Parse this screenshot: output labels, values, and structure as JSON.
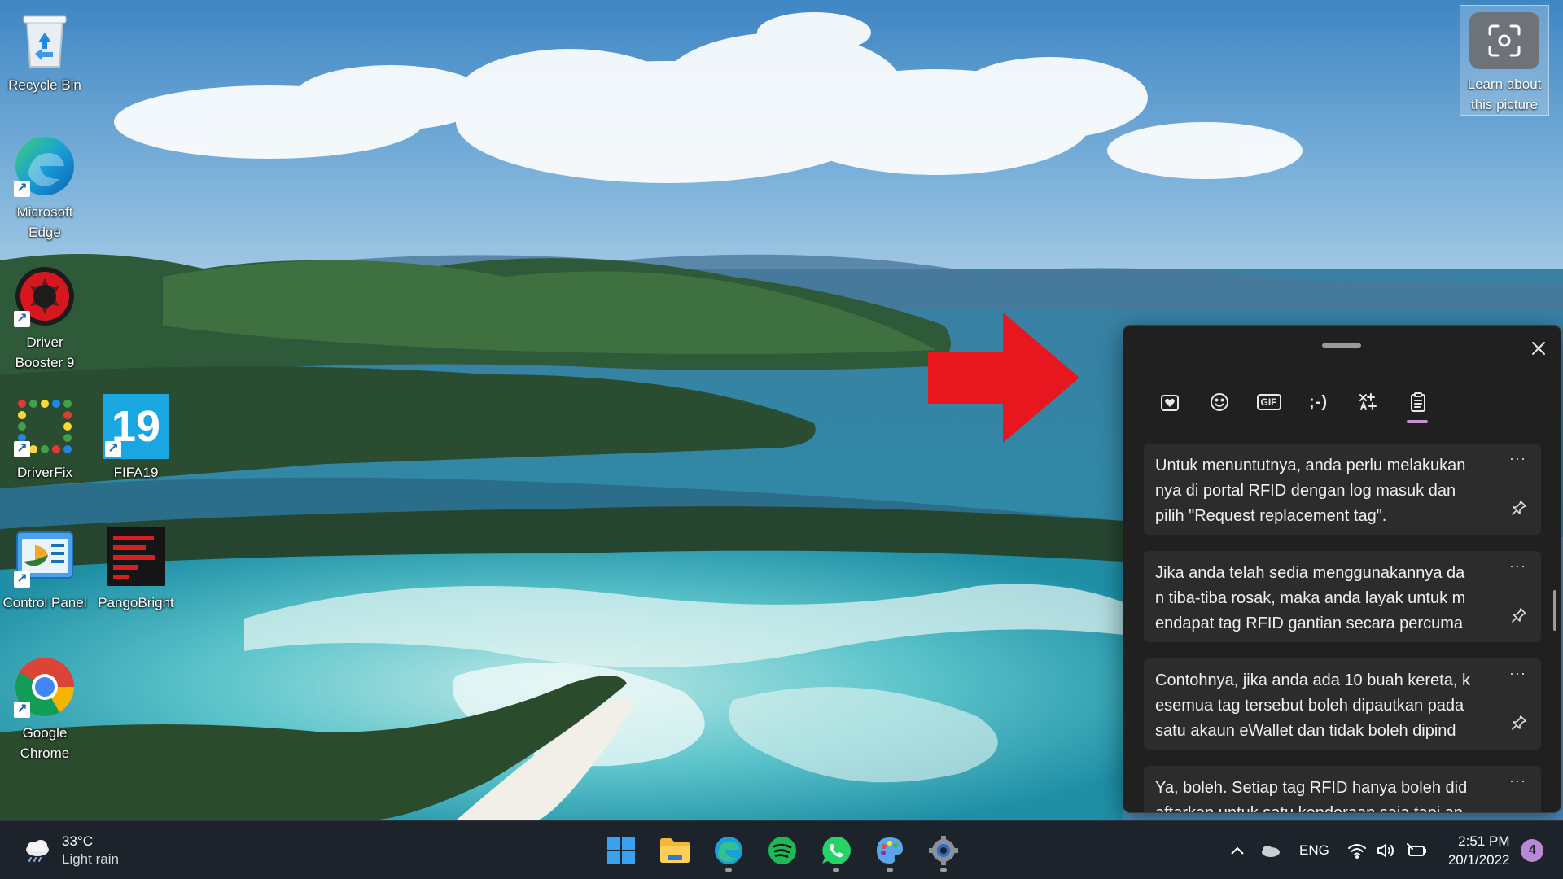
{
  "desktop": {
    "icons": [
      {
        "label": "Recycle Bin"
      },
      {
        "label": "Microsoft\nEdge"
      },
      {
        "label": "Driver\nBooster 9"
      },
      {
        "label": "DriverFix"
      },
      {
        "label": "FIFA19"
      },
      {
        "label": "Control Panel"
      },
      {
        "label": "PangoBright"
      },
      {
        "label": "Google\nChrome"
      }
    ],
    "learn_tile_label": "Learn about\nthis picture",
    "fifa_glyph_text": "19"
  },
  "panel": {
    "tabs": [
      {
        "icon": "heart-icon",
        "text": ""
      },
      {
        "icon": "smiley-icon",
        "text": ""
      },
      {
        "icon": "gif-icon",
        "text": "GIF"
      },
      {
        "icon": "kaomoji-icon",
        "text": ";-)"
      },
      {
        "icon": "symbols-icon",
        "text": ""
      },
      {
        "icon": "clipboard-icon",
        "text": ""
      }
    ],
    "active_tab": 5,
    "clipboard_items": [
      {
        "text": "Untuk menuntutnya, anda perlu melakukan\nnya di portal RFID dengan log masuk dan\npilih \"Request replacement tag\"."
      },
      {
        "text": "Jika anda telah sedia menggunakannya da\nn tiba-tiba rosak, maka anda layak untuk m\nendapat tag RFID gantian secara percuma"
      },
      {
        "text": "Contohnya, jika anda ada 10 buah kereta, k\nesemua tag tersebut boleh dipautkan pada\nsatu akaun eWallet dan tidak boleh dipind"
      },
      {
        "text": "Ya, boleh. Setiap tag RFID hanya boleh did\naftarkan untuk satu kenderaan saja tapi an"
      }
    ],
    "more_glyph": "···"
  },
  "taskbar": {
    "weather": {
      "temp": "33°C",
      "condition": "Light rain"
    },
    "apps": [
      "start",
      "file-explorer",
      "edge",
      "spotify",
      "whatsapp",
      "paint",
      "settings"
    ],
    "language": "ENG",
    "time": "2:51 PM",
    "date": "20/1/2022",
    "notification_count": "4"
  },
  "colors": {
    "accent": "#c991d6",
    "arrow": "#e8161e",
    "panel_bg": "#202020",
    "item_bg": "#2c2c2c"
  }
}
